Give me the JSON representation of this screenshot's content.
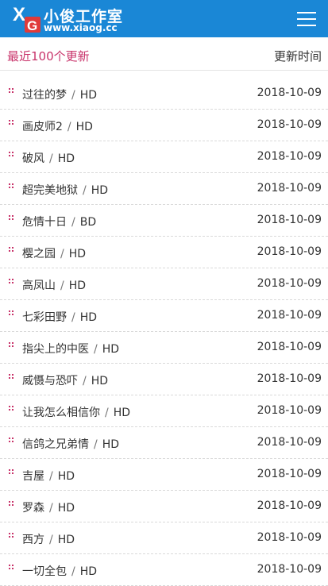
{
  "header": {
    "logo_mark_letters": "XG",
    "site_name": "小俊工作室",
    "site_url": "www.xiaog.cc",
    "menu_icon": "hamburger-menu-icon",
    "colors": {
      "bar": "#1a87d6",
      "accent": "#c8336a"
    }
  },
  "section": {
    "title": "最近100个更新",
    "time_label": "更新时间"
  },
  "items": [
    {
      "name": "过往的梦",
      "quality": "HD",
      "date": "2018-10-09"
    },
    {
      "name": "画皮师2",
      "quality": "HD",
      "date": "2018-10-09"
    },
    {
      "name": "破风",
      "quality": "HD",
      "date": "2018-10-09"
    },
    {
      "name": "超完美地狱",
      "quality": "HD",
      "date": "2018-10-09"
    },
    {
      "name": "危情十日",
      "quality": "BD",
      "date": "2018-10-09"
    },
    {
      "name": "樱之园",
      "quality": "HD",
      "date": "2018-10-09"
    },
    {
      "name": "高凤山",
      "quality": "HD",
      "date": "2018-10-09"
    },
    {
      "name": "七彩田野",
      "quality": "HD",
      "date": "2018-10-09"
    },
    {
      "name": "指尖上的中医",
      "quality": "HD",
      "date": "2018-10-09"
    },
    {
      "name": "威慑与恐吓",
      "quality": "HD",
      "date": "2018-10-09"
    },
    {
      "name": "让我怎么相信你",
      "quality": "HD",
      "date": "2018-10-09"
    },
    {
      "name": "信鸽之兄弟情",
      "quality": "HD",
      "date": "2018-10-09"
    },
    {
      "name": "吉屋",
      "quality": "HD",
      "date": "2018-10-09"
    },
    {
      "name": "罗森",
      "quality": "HD",
      "date": "2018-10-09"
    },
    {
      "name": "西方",
      "quality": "HD",
      "date": "2018-10-09"
    },
    {
      "name": "一切全包",
      "quality": "HD",
      "date": "2018-10-09"
    }
  ]
}
